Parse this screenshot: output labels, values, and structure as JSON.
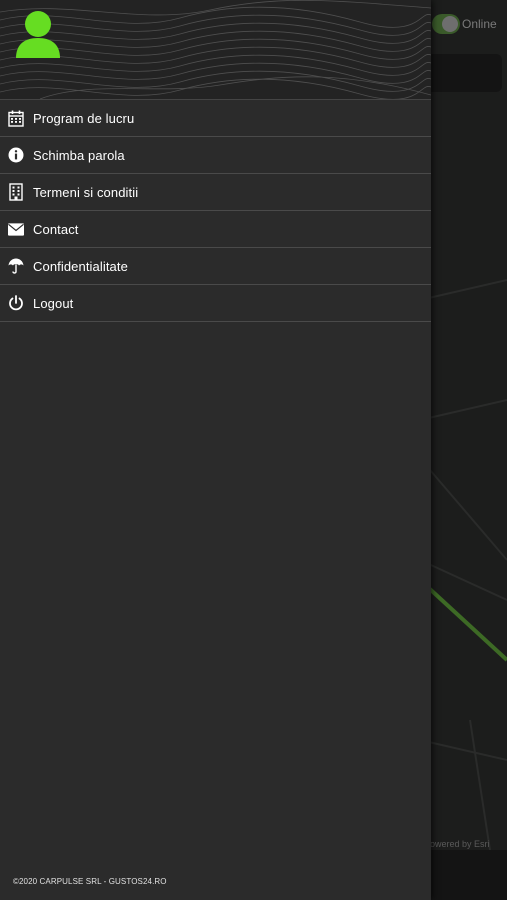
{
  "status": {
    "online_label": "Online"
  },
  "map": {
    "attribution": "Powered by Esri"
  },
  "drawer": {
    "avatar_color": "#66dd22",
    "menu": [
      {
        "label": "Program de lucru",
        "icon": "calendar-icon"
      },
      {
        "label": "Schimba parola",
        "icon": "info-icon"
      },
      {
        "label": "Termeni si conditii",
        "icon": "building-icon"
      },
      {
        "label": "Contact",
        "icon": "envelope-icon"
      },
      {
        "label": "Confidentialitate",
        "icon": "umbrella-icon"
      },
      {
        "label": "Logout",
        "icon": "power-icon"
      }
    ],
    "footer": "©2020 CARPULSE SRL - GUSTOS24.RO"
  },
  "colors": {
    "drawer_bg": "#2b2b2b",
    "header_bg": "#232323",
    "divider": "#4a4a4a",
    "text": "#ffffff",
    "accent_green": "#66dd22"
  }
}
